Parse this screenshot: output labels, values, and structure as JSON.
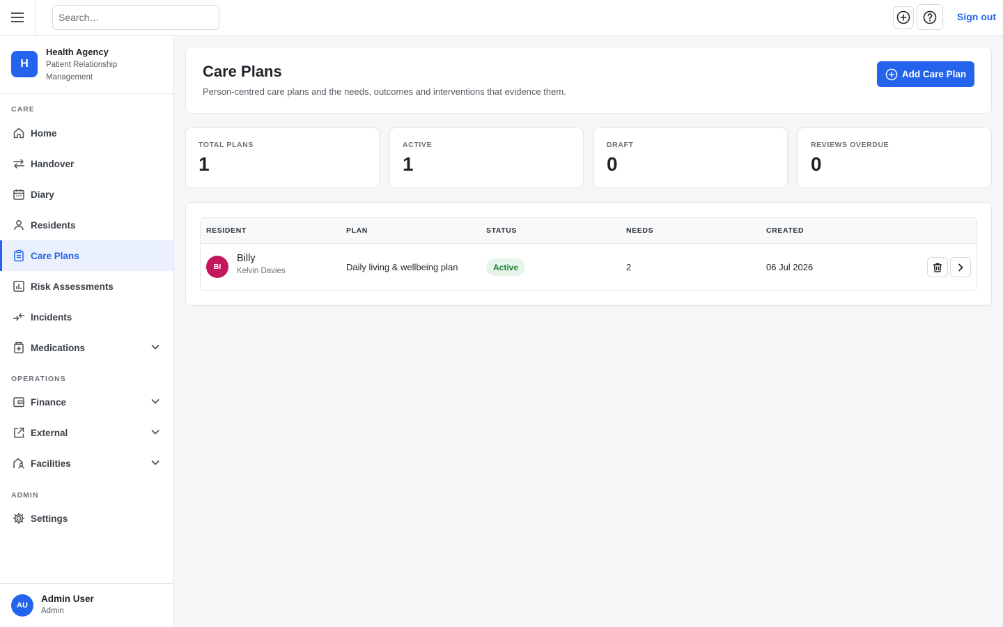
{
  "topbar": {
    "search_placeholder": "Search…",
    "signout_label": "Sign out"
  },
  "brand": {
    "logo_letter": "H",
    "name": "Health Agency",
    "subtitle": "Patient Relationship Management"
  },
  "sidebar": {
    "sections": {
      "care": "CARE",
      "operations": "OPERATIONS",
      "admin": "ADMIN"
    },
    "items": [
      {
        "label": "Home",
        "icon": "home-icon"
      },
      {
        "label": "Handover",
        "icon": "arrows-swap-icon"
      },
      {
        "label": "Diary",
        "icon": "calendar-icon"
      },
      {
        "label": "Residents",
        "icon": "user-icon"
      },
      {
        "label": "Care Plans",
        "icon": "clipboard-icon",
        "active": true
      },
      {
        "label": "Risk Assessments",
        "icon": "chart-icon"
      },
      {
        "label": "Incidents",
        "icon": "arrows-in-icon"
      },
      {
        "label": "Medications",
        "icon": "medicine-icon",
        "expandable": true
      },
      {
        "label": "Finance",
        "icon": "wallet-icon",
        "expandable": true
      },
      {
        "label": "External",
        "icon": "external-link-icon",
        "expandable": true
      },
      {
        "label": "Facilities",
        "icon": "building-icon",
        "expandable": true
      },
      {
        "label": "Settings",
        "icon": "gear-icon"
      }
    ]
  },
  "user": {
    "initials": "AU",
    "name": "Admin User",
    "role": "Admin"
  },
  "page": {
    "title": "Care Plans",
    "subtitle": "Person-centred care plans and the needs, outcomes and interventions that evidence them.",
    "add_button": "Add Care Plan"
  },
  "stats": [
    {
      "label": "TOTAL PLANS",
      "value": "1"
    },
    {
      "label": "ACTIVE",
      "value": "1"
    },
    {
      "label": "DRAFT",
      "value": "0"
    },
    {
      "label": "REVIEWS OVERDUE",
      "value": "0"
    }
  ],
  "table": {
    "columns": [
      "RESIDENT",
      "PLAN",
      "STATUS",
      "NEEDS",
      "CREATED"
    ],
    "rows": [
      {
        "initials": "BI",
        "resident": "Billy",
        "contact": "Kelvin Davies",
        "plan": "Daily living & wellbeing plan",
        "status": "Active",
        "needs": "2",
        "created": "06 Jul 2026"
      }
    ]
  },
  "colors": {
    "accent": "#2463eb",
    "active_bg": "#eaf0fd",
    "status_active_bg": "#e6f4ea",
    "status_active_fg": "#1e7e34",
    "resident_avatar": "#c2185b"
  }
}
